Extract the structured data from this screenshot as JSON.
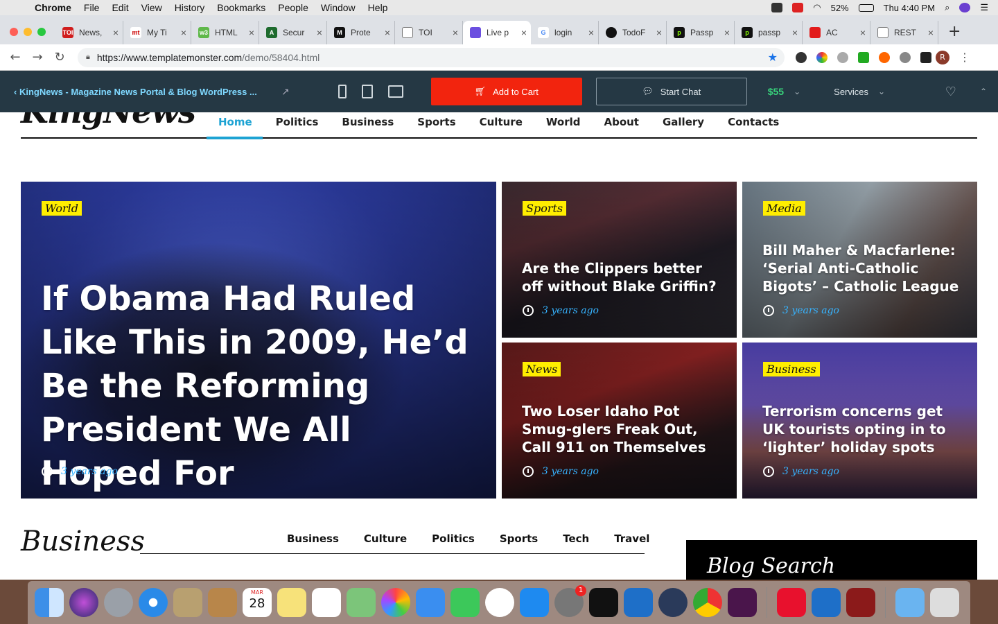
{
  "menubar": {
    "app": "Chrome",
    "items": [
      "File",
      "Edit",
      "View",
      "History",
      "Bookmarks",
      "People",
      "Window",
      "Help"
    ],
    "battery": "52%",
    "clock": "Thu 4:40 PM"
  },
  "tabs": [
    {
      "label": "News,",
      "color": "#d01d1d",
      "glyph": "TOI"
    },
    {
      "label": "My Ti",
      "color": "#ffffff",
      "glyph": "mt"
    },
    {
      "label": "HTML",
      "color": "#5fb84a",
      "glyph": "w3"
    },
    {
      "label": "Secur",
      "color": "#1e6b2e",
      "glyph": "A"
    },
    {
      "label": "Prote",
      "color": "#111111",
      "glyph": "M"
    },
    {
      "label": "TOI",
      "color": "#ffffff",
      "glyph": ""
    },
    {
      "label": "Live p",
      "color": "#6b4fe0",
      "glyph": ""
    },
    {
      "label": "login",
      "color": "#ffffff",
      "glyph": "G"
    },
    {
      "label": "TodoF",
      "color": "#111111",
      "glyph": ""
    },
    {
      "label": "Passp",
      "color": "#111111",
      "glyph": "p"
    },
    {
      "label": "passp",
      "color": "#111111",
      "glyph": "p"
    },
    {
      "label": "AC",
      "color": "#e21b1b",
      "glyph": ""
    },
    {
      "label": "REST",
      "color": "#ffffff",
      "glyph": ""
    }
  ],
  "address": {
    "host": "https://www.templatemonster.com",
    "path": "/demo/58404.html"
  },
  "tmbar": {
    "title": "KingNews - Magazine News Portal & Blog WordPress ...",
    "add_to_cart": "Add to Cart",
    "start_chat": "Start Chat",
    "price": "$55",
    "services": "Services"
  },
  "site": {
    "logo": "KingNews",
    "nav": [
      "Home",
      "Politics",
      "Business",
      "Sports",
      "Culture",
      "World",
      "About",
      "Gallery",
      "Contacts"
    ]
  },
  "articles": {
    "main": {
      "category": "World",
      "title": "If Obama Had Ruled Like This in 2009, He’d Be the Reforming President We All Hoped For",
      "time": "3 years ago"
    },
    "a1": {
      "category": "Sports",
      "title": "Are the Clippers better off without Blake Griffin?",
      "time": "3 years ago"
    },
    "a2": {
      "category": "Media",
      "title": "Bill Maher & Macfarlene: ‘Serial Anti-Catholic Bigots’ – Catholic League",
      "time": "3 years ago"
    },
    "a3": {
      "category": "News",
      "title": "Two Loser Idaho Pot Smug-glers Freak Out, Call 911 on Themselves",
      "time": "3 years ago"
    },
    "a4": {
      "category": "Business",
      "title": "Terrorism concerns get UK tourists opting in to ‘lighter’ holiday spots",
      "time": "3 years ago"
    }
  },
  "business_section": {
    "title": "Business",
    "tabs": [
      "Business",
      "Culture",
      "Politics",
      "Sports",
      "Tech",
      "Travel"
    ]
  },
  "sidebar": {
    "blog_search": "Blog Search"
  },
  "dock": {
    "calendar_month": "MAR",
    "calendar_day": "28",
    "badge": "1"
  }
}
